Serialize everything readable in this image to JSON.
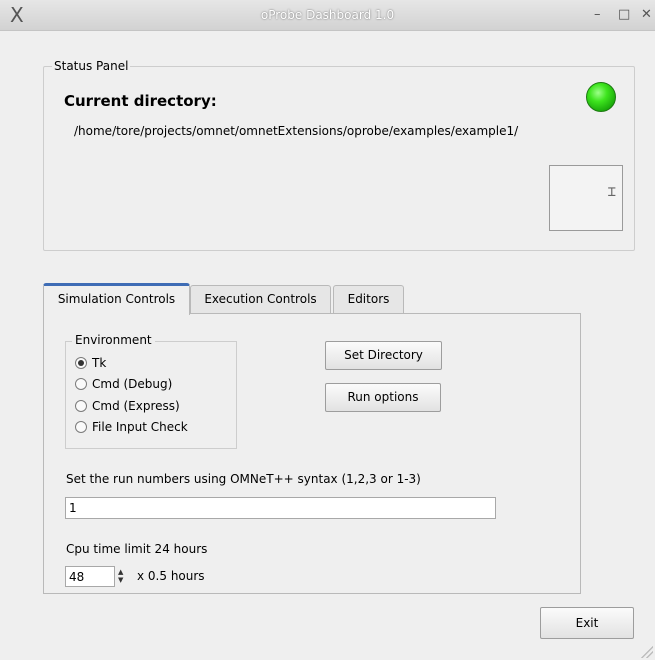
{
  "window": {
    "title": "oProbe Dashboard 1.0",
    "close_icon_left": "X",
    "minimize_glyph": "–",
    "maximize_glyph": "□",
    "close_glyph": "✕"
  },
  "status_panel": {
    "legend": "Status Panel",
    "current_directory_label": "Current directory:",
    "directory_path": "/home/tore/projects/omnet/omnetExtensions/oprobe/examples/example1/",
    "status_led_color": "#3ee51e",
    "thumbnail_glyph": "⌶"
  },
  "tabs": [
    {
      "label": "Simulation Controls",
      "active": true
    },
    {
      "label": "Execution Controls",
      "active": false
    },
    {
      "label": "Editors",
      "active": false
    }
  ],
  "simulation": {
    "environment_legend": "Environment",
    "environment_options": [
      {
        "label": "Tk",
        "selected": true
      },
      {
        "label": "Cmd (Debug)",
        "selected": false
      },
      {
        "label": "Cmd (Express)",
        "selected": false
      },
      {
        "label": "File Input Check",
        "selected": false
      }
    ],
    "set_directory_label": "Set Directory",
    "run_options_label": "Run options",
    "run_numbers_label": "Set the run numbers using OMNeT++ syntax (1,2,3 or 1-3)",
    "run_numbers_value": "1",
    "cpu_limit_label": "Cpu time limit 24 hours",
    "cpu_limit_value": "48",
    "cpu_limit_suffix": "x 0.5 hours"
  },
  "footer": {
    "exit_label": "Exit"
  }
}
